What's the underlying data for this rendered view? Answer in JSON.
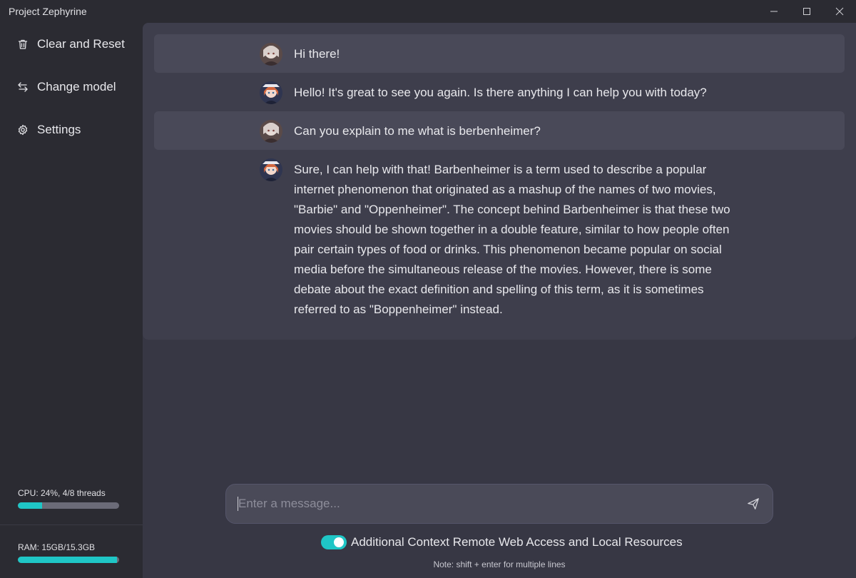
{
  "window": {
    "title": "Project Zephyrine"
  },
  "sidebar": {
    "items": [
      {
        "label": "Clear and Reset",
        "icon": "trash-icon"
      },
      {
        "label": "Change model",
        "icon": "swap-arrows-icon"
      },
      {
        "label": "Settings",
        "icon": "gear-icon"
      }
    ],
    "cpu": {
      "label": "CPU: 24%, 4/8 threads",
      "usage": 0.24
    },
    "ram": {
      "label": "RAM: 15GB/15.3GB",
      "usage": 0.98
    }
  },
  "chat": {
    "messages": [
      {
        "role": "user",
        "text": "Hi there!"
      },
      {
        "role": "assistant",
        "text": "Hello! It's great to see you again. Is there anything I can help you with today?"
      },
      {
        "role": "user",
        "text": "Can you explain to me what is berbenheimer?"
      },
      {
        "role": "assistant",
        "text": "Sure, I can help with that! Barbenheimer is a term used to describe a popular internet phenomenon that originated as a mashup of the names of two movies, \"Barbie\" and \"Oppenheimer\". The concept behind Barbenheimer is that these two movies should be shown together in a double feature, similar to how people often pair certain types of food or drinks. This phenomenon became popular on social media before the simultaneous release of the movies. However, there is some debate about the exact definition and spelling of this term, as it is sometimes referred to as \"Boppenheimer\" instead."
      }
    ]
  },
  "composer": {
    "placeholder": "Enter a message...",
    "value": "",
    "toggle_label": "Additional Context Remote Web Access and Local Resources",
    "toggle_on": true,
    "note": "Note: shift + enter for multiple lines"
  },
  "colors": {
    "accent": "#1fc6c6",
    "background": "#2b2b32",
    "panel": "#3e3e4c"
  }
}
